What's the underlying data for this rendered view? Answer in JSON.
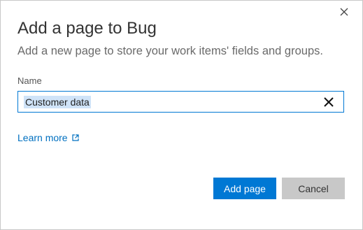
{
  "dialog": {
    "title": "Add a page to Bug",
    "subtitle": "Add a new page to store your work items' fields and groups."
  },
  "form": {
    "name_label": "Name",
    "name_value": "Customer data"
  },
  "links": {
    "learn_more": "Learn more"
  },
  "buttons": {
    "primary": "Add page",
    "secondary": "Cancel"
  },
  "icons": {
    "close": "close-icon",
    "clear": "clear-icon",
    "external": "external-link-icon"
  },
  "colors": {
    "accent": "#0078d4",
    "link": "#0070c0",
    "secondary_button": "#c8c8c8"
  }
}
